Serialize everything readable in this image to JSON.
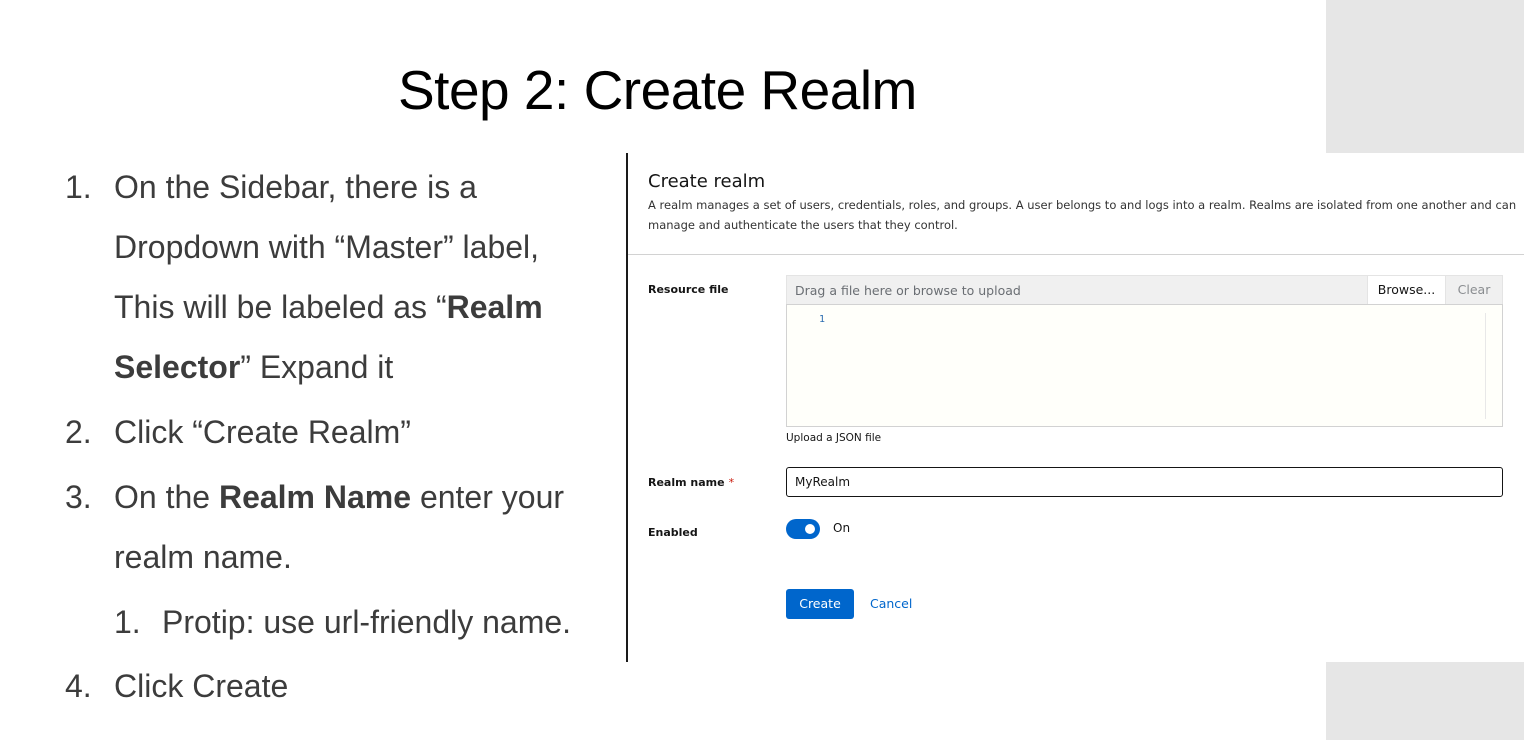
{
  "slide": {
    "title": "Step 2: Create Realm"
  },
  "steps": {
    "s1": {
      "num": "1.",
      "line1": "On the Sidebar, there is a",
      "line2": "Dropdown with “Master” label,",
      "line3_pre": "This will be labeled as “",
      "line3_bold": "Realm",
      "line4_bold": "Selector",
      "line4_post": "” Expand it"
    },
    "s2": {
      "num": "2.",
      "text": "Click “Create Realm”"
    },
    "s3": {
      "num": "3.",
      "line1_pre": "On the ",
      "line1_bold": "Realm Name",
      "line1_post": " enter your",
      "line2": "realm name.",
      "sub_num": "1.",
      "sub_text": "Protip: use url-friendly name."
    },
    "s4": {
      "num": "4.",
      "text": "Click Create"
    }
  },
  "form": {
    "title": "Create realm",
    "description": "A realm manages a set of users, credentials, roles, and groups. A user belongs to and logs into a realm. Realms are isolated from one another and can manage and authenticate the users that they control.",
    "resource_file": {
      "label": "Resource file",
      "placeholder": "Drag a file here or browse to upload",
      "browse_label": "Browse...",
      "clear_label": "Clear",
      "line_number": "1",
      "helper": "Upload a JSON file"
    },
    "realm_name": {
      "label": "Realm name",
      "required_mark": "*",
      "value": "MyRealm"
    },
    "enabled": {
      "label": "Enabled",
      "state_text": "On",
      "on": true
    },
    "actions": {
      "create_label": "Create",
      "cancel_label": "Cancel"
    },
    "colors": {
      "primary": "#0066cc",
      "required": "#c9190b"
    }
  }
}
